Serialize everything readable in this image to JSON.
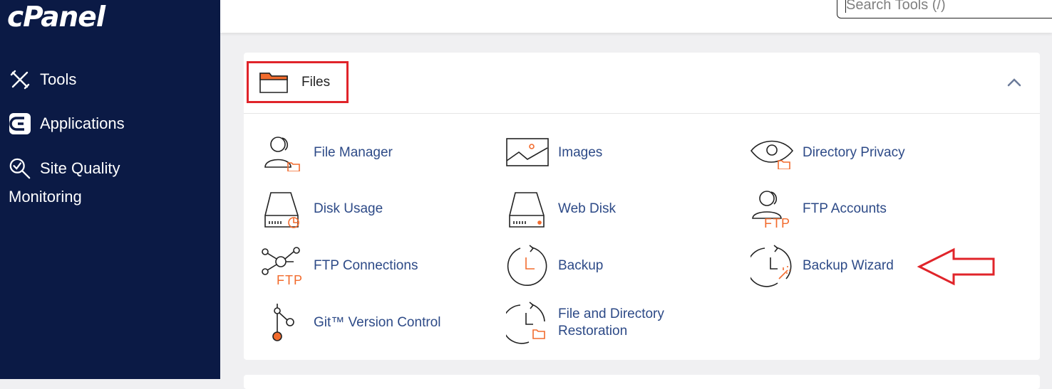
{
  "sidebar": {
    "logo": "cPanel",
    "items": [
      {
        "label": "Tools",
        "icon": "tools-icon"
      },
      {
        "label": "Applications",
        "icon": "applications-icon"
      },
      {
        "label": "Site Quality",
        "label_cont": "Monitoring",
        "icon": "site-quality-icon"
      }
    ]
  },
  "search": {
    "placeholder": "Search Tools (/)"
  },
  "section": {
    "title": "Files",
    "tools": [
      {
        "label": "File Manager",
        "icon": "file-manager-icon"
      },
      {
        "label": "Images",
        "icon": "images-icon"
      },
      {
        "label": "Directory Privacy",
        "icon": "directory-privacy-icon"
      },
      {
        "label": "Disk Usage",
        "icon": "disk-usage-icon"
      },
      {
        "label": "Web Disk",
        "icon": "web-disk-icon"
      },
      {
        "label": "FTP Accounts",
        "icon": "ftp-accounts-icon"
      },
      {
        "label": "FTP Connections",
        "icon": "ftp-connections-icon"
      },
      {
        "label": "Backup",
        "icon": "backup-icon"
      },
      {
        "label": "Backup Wizard",
        "icon": "backup-wizard-icon"
      },
      {
        "label": "Git™ Version Control",
        "icon": "git-icon"
      },
      {
        "label": "File and Directory",
        "label_line2": "Restoration",
        "icon": "restore-icon"
      }
    ]
  },
  "icon_text": {
    "ftp": "FTP"
  },
  "colors": {
    "sidebar_bg": "#0b1a45",
    "accent_orange": "#f26b2d",
    "link_blue": "#2d4a87",
    "highlight_red": "#e0242a"
  }
}
